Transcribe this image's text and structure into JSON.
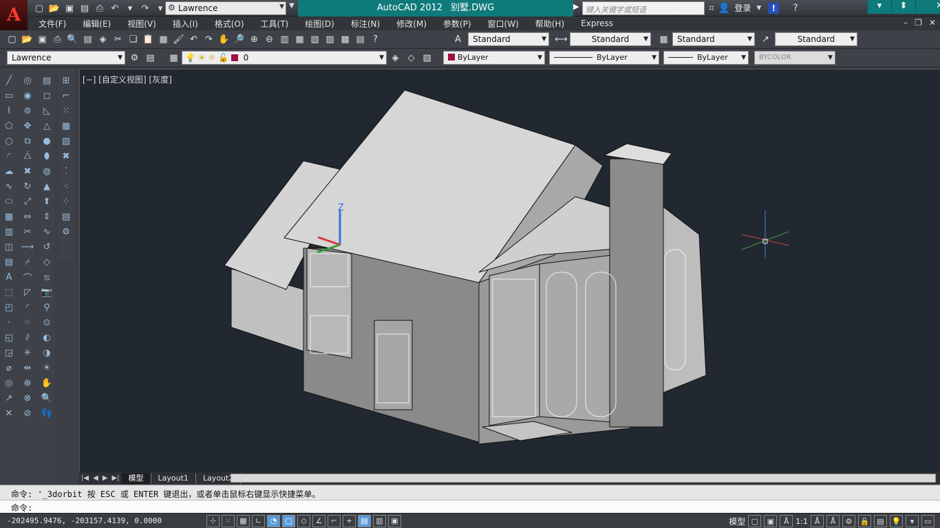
{
  "title": {
    "app": "AutoCAD 2012",
    "file": "别墅.DWG",
    "workspace": "Lawrence",
    "search_placeholder": "键入关键字或短语",
    "login": "登录",
    "logo": "A"
  },
  "menus": [
    "文件(F)",
    "编辑(E)",
    "视图(V)",
    "插入(I)",
    "格式(O)",
    "工具(T)",
    "绘图(D)",
    "标注(N)",
    "修改(M)",
    "参数(P)",
    "窗口(W)",
    "帮助(H)",
    "Express"
  ],
  "styles": {
    "text": "Standard",
    "dim": "Standard",
    "table": "Standard",
    "mleader": "Standard"
  },
  "layer": {
    "workspace_combo": "Lawrence",
    "current": "0",
    "color": "ByLayer",
    "linetype": "ByLayer",
    "lineweight": "ByLayer",
    "plotstyle": "BYCOLOR"
  },
  "viewport": {
    "label": "[−] [自定义视图] [灰度]",
    "ucs_z": "Z"
  },
  "tabs": [
    "模型",
    "Layout1",
    "Layout2"
  ],
  "command": {
    "history": "命令: '_3dorbit 按 ESC 或 ENTER 键退出，或者单击鼠标右键显示快捷菜单。",
    "prompt": "命令:"
  },
  "status": {
    "coords": "-202495.9476, -203157.4139, 0.0000",
    "space": "模型",
    "scale": "1:1"
  },
  "colors": {
    "layer_swatch": "#a01040",
    "title_accent": "#0f7a7a",
    "viewport_bg": "#212830"
  },
  "icons": {
    "window_minimize": "▾",
    "window_restore": "⬍",
    "window_close": "✕",
    "help": "?",
    "info": "!"
  }
}
